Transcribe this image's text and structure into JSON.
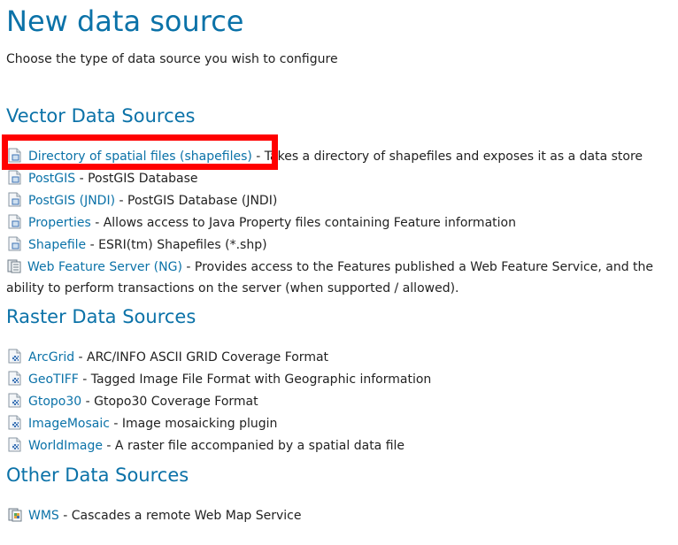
{
  "page": {
    "title": "New data source",
    "subtitle": "Choose the type of data source you wish to configure"
  },
  "sections": {
    "vector": {
      "heading": "Vector Data Sources",
      "items": [
        {
          "label": "Directory of spatial files (shapefiles)",
          "description": " - Takes a directory of shapefiles and exposes it as a data store",
          "icon": "vector-file-icon"
        },
        {
          "label": "PostGIS",
          "description": " - PostGIS Database",
          "icon": "vector-file-icon"
        },
        {
          "label": "PostGIS (JNDI)",
          "description": " - PostGIS Database (JNDI)",
          "icon": "vector-file-icon"
        },
        {
          "label": "Properties",
          "description": " - Allows access to Java Property files containing Feature information",
          "icon": "vector-file-icon"
        },
        {
          "label": "Shapefile",
          "description": " - ESRI(tm) Shapefiles (*.shp)",
          "icon": "vector-file-icon"
        },
        {
          "label": "Web Feature Server (NG)",
          "description": " - Provides access to the Features published a Web Feature Service, and the ability to perform transactions on the server (when supported / allowed).",
          "icon": "server-icon"
        }
      ]
    },
    "raster": {
      "heading": "Raster Data Sources",
      "items": [
        {
          "label": "ArcGrid",
          "description": " - ARC/INFO ASCII GRID Coverage Format",
          "icon": "raster-file-icon"
        },
        {
          "label": "GeoTIFF",
          "description": " - Tagged Image File Format with Geographic information",
          "icon": "raster-file-icon"
        },
        {
          "label": "Gtopo30",
          "description": " - Gtopo30 Coverage Format",
          "icon": "raster-file-icon"
        },
        {
          "label": "ImageMosaic",
          "description": " - Image mosaicking plugin",
          "icon": "raster-file-icon"
        },
        {
          "label": "WorldImage",
          "description": " - A raster file accompanied by a spatial data file",
          "icon": "raster-file-icon"
        }
      ]
    },
    "other": {
      "heading": "Other Data Sources",
      "items": [
        {
          "label": "WMS",
          "description": " - Cascades a remote Web Map Service",
          "icon": "wms-server-icon"
        }
      ]
    }
  },
  "colors": {
    "link": "#0b72a8",
    "heading": "#0b72a8",
    "highlight": "#ff0000"
  }
}
